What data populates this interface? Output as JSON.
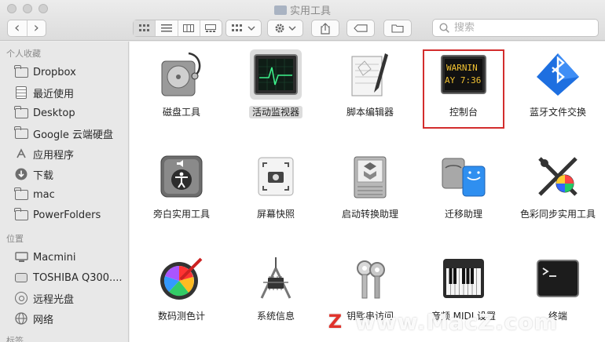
{
  "window": {
    "title": "实用工具"
  },
  "toolbar": {
    "back_glyph": "‹",
    "forward_glyph": "›",
    "search_placeholder": "搜索"
  },
  "sidebar": {
    "sections": [
      {
        "header": "个人收藏",
        "items": [
          {
            "label": "Dropbox",
            "icon": "folder-icon"
          },
          {
            "label": "最近使用",
            "icon": "recents-icon"
          },
          {
            "label": "Desktop",
            "icon": "folder-icon"
          },
          {
            "label": "Google 云端硬盘",
            "icon": "folder-icon"
          },
          {
            "label": "应用程序",
            "icon": "applications-icon"
          },
          {
            "label": "下载",
            "icon": "download-icon"
          },
          {
            "label": "mac",
            "icon": "folder-icon"
          },
          {
            "label": "PowerFolders",
            "icon": "folder-icon"
          }
        ]
      },
      {
        "header": "位置",
        "items": [
          {
            "label": "Macmini",
            "icon": "computer-icon"
          },
          {
            "label": "TOSHIBA Q300....",
            "icon": "disk-icon"
          },
          {
            "label": "远程光盘",
            "icon": "disc-icon"
          },
          {
            "label": "网络",
            "icon": "network-icon"
          }
        ]
      },
      {
        "header": "标签"
      }
    ]
  },
  "apps": [
    {
      "label": "磁盘工具",
      "icon": "disk-utility-icon"
    },
    {
      "label": "活动监视器",
      "icon": "activity-monitor-icon",
      "selected": true
    },
    {
      "label": "脚本编辑器",
      "icon": "script-editor-icon"
    },
    {
      "label": "控制台",
      "icon": "console-icon",
      "console_line1": "WARNIN",
      "console_line2": "AY 7:36"
    },
    {
      "label": "蓝牙文件交换",
      "icon": "bluetooth-exchange-icon"
    },
    {
      "label": "旁白实用工具",
      "icon": "voiceover-utility-icon"
    },
    {
      "label": "屏幕快照",
      "icon": "screenshot-icon"
    },
    {
      "label": "启动转换助理",
      "icon": "boot-camp-icon"
    },
    {
      "label": "迁移助理",
      "icon": "migration-assistant-icon"
    },
    {
      "label": "色彩同步实用工具",
      "icon": "colorsync-icon"
    },
    {
      "label": "数码测色计",
      "icon": "digital-color-meter-icon"
    },
    {
      "label": "系统信息",
      "icon": "system-information-icon"
    },
    {
      "label": "钥匙串访问",
      "icon": "keychain-access-icon"
    },
    {
      "label": "音频 MIDI 设置",
      "icon": "audio-midi-icon"
    },
    {
      "label": "终端",
      "icon": "terminal-icon"
    }
  ],
  "watermark": {
    "text": "www.MacZ.com",
    "badge": "Z"
  },
  "colors": {
    "highlight": "#d32d2d",
    "selection": "#dcdcdc"
  }
}
